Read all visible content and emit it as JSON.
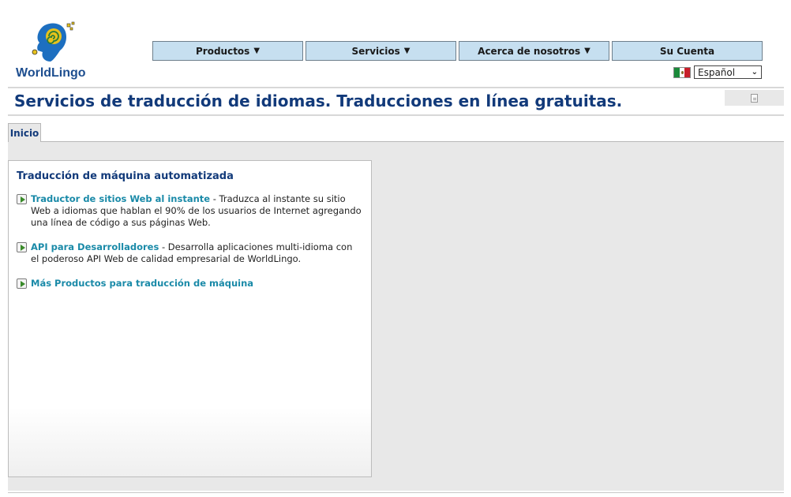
{
  "brand": {
    "name_part1": "World",
    "name_part2": "Lingo"
  },
  "nav": {
    "items": [
      {
        "label": "Productos",
        "arrow": "▼"
      },
      {
        "label": "Servicios",
        "arrow": "▼"
      },
      {
        "label": "Acerca de nosotros",
        "arrow": "▼"
      },
      {
        "label": "Su Cuenta",
        "arrow": ""
      }
    ]
  },
  "language": {
    "selected": "Español",
    "flag": "mexico-flag"
  },
  "page": {
    "title": "Servicios de traducción de idiomas. Traducciones en línea gratuitas."
  },
  "tabs": [
    {
      "label": "Inicio",
      "active": true
    }
  ],
  "card": {
    "title": "Traducción de máquina automatizada",
    "items": [
      {
        "link": "Traductor de sitios Web al instante",
        "separator": " - ",
        "text": "Traduzca al instante su sitio Web a idiomas que hablan el 90% de los usuarios de Internet agregando una línea de código a sus páginas Web."
      },
      {
        "link": "API para Desarrolladores",
        "separator": " - ",
        "text": "Desarrolla aplicaciones multi-idioma con el poderoso API Web de calidad empresarial de WorldLingo."
      },
      {
        "link": "Más Productos para traducción de máquina",
        "separator": "",
        "text": ""
      }
    ]
  },
  "colors": {
    "accent": "#123a7a",
    "link": "#1a8aa8",
    "nav_bg": "#c6dff0",
    "panel_bg": "#e8e8e8"
  }
}
